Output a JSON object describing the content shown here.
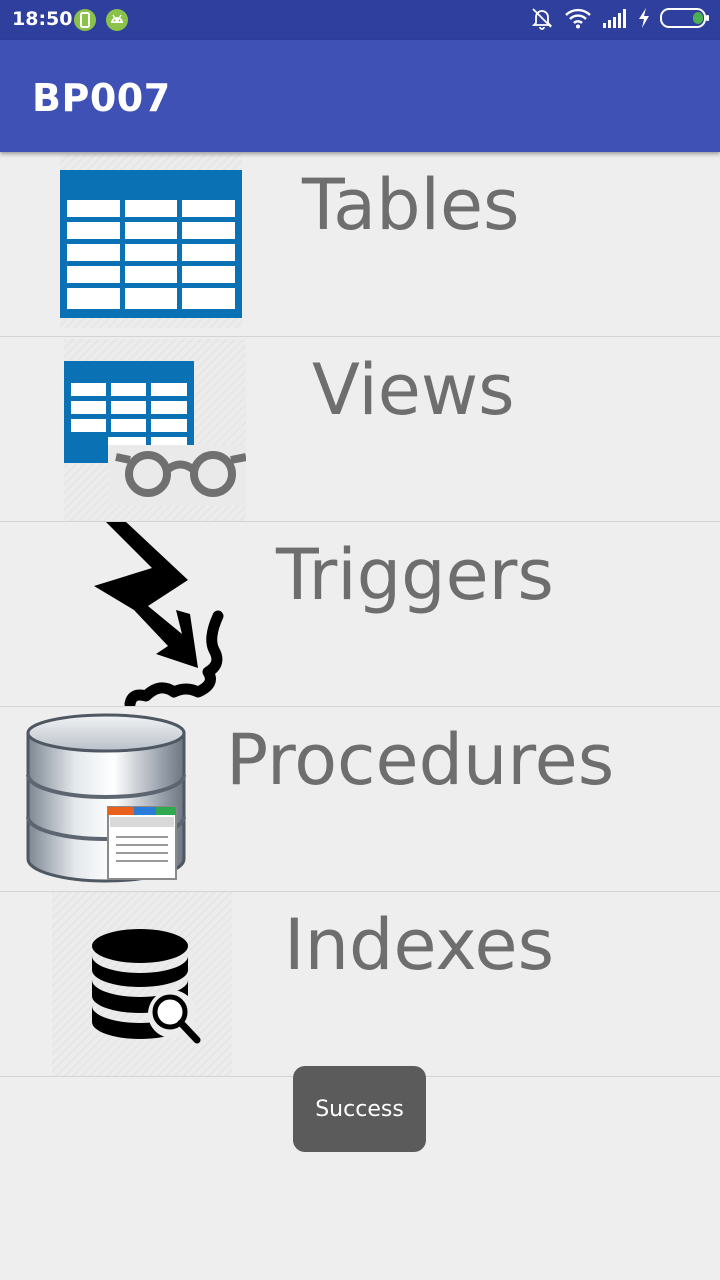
{
  "status_bar": {
    "time": "18:50",
    "left_icons": [
      "phone-notification-icon",
      "android-notification-icon"
    ],
    "right_icons": [
      "bell-off-icon",
      "wifi-icon",
      "signal-icon",
      "charging-bolt-icon",
      "battery-icon"
    ],
    "colors": {
      "background": "#2f3f9e",
      "notif_green": "#8bc34a",
      "battery_green": "#4caf50"
    }
  },
  "app_bar": {
    "title": "BP007",
    "color": "#3f51b5"
  },
  "menu": {
    "items": [
      {
        "label": "Tables",
        "icon": "table-icon"
      },
      {
        "label": "Views",
        "icon": "view-table-glasses-icon"
      },
      {
        "label": "Triggers",
        "icon": "lightning-trigger-icon"
      },
      {
        "label": "Procedures",
        "icon": "database-procedure-icon"
      },
      {
        "label": "Indexes",
        "icon": "database-search-icon"
      }
    ]
  },
  "toast": {
    "text": "Success"
  }
}
